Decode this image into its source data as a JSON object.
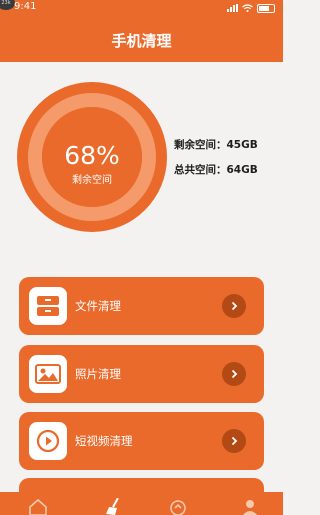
{
  "status_bar": {
    "time": "9:41",
    "badge": "23k"
  },
  "header": {
    "title": "手机清理"
  },
  "storage": {
    "used_percent_label": "68%",
    "used_fraction": 0.68,
    "circle_caption": "剩余空间",
    "remaining_label": "剩余空间：",
    "remaining_value": "45GB",
    "total_label": "总共空间：",
    "total_value": "64GB"
  },
  "menu": [
    {
      "label": "文件清理",
      "icon": "file-cabinet-icon"
    },
    {
      "label": "照片清理",
      "icon": "photo-icon"
    },
    {
      "label": "短视频清理",
      "icon": "video-play-icon"
    }
  ],
  "bottom_nav": [
    "home-icon",
    "broom-icon",
    "cleanup-icon",
    "profile-icon"
  ],
  "colors": {
    "accent": "#e96a2b",
    "accent_dark": "#b34a16",
    "ring_light": "#f59a6a",
    "background": "#f3f2f1"
  }
}
